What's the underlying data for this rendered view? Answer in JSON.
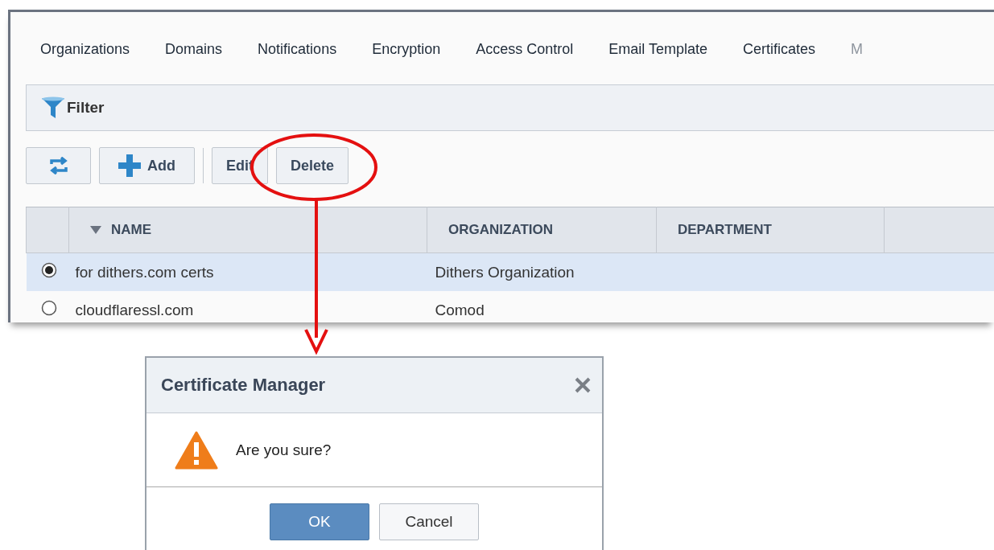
{
  "tabs": [
    {
      "label": "Organizations",
      "disabled": false
    },
    {
      "label": "Domains",
      "disabled": false
    },
    {
      "label": "Notifications",
      "disabled": false
    },
    {
      "label": "Encryption",
      "disabled": false
    },
    {
      "label": "Access Control",
      "disabled": false
    },
    {
      "label": "Email Template",
      "disabled": false
    },
    {
      "label": "Certificates",
      "disabled": false
    },
    {
      "label": "M",
      "disabled": true
    }
  ],
  "filter": {
    "label": "Filter"
  },
  "toolbar": [
    {
      "kind": "refresh"
    },
    {
      "kind": "add",
      "label": "Add"
    },
    {
      "kind": "separator"
    },
    {
      "kind": "text",
      "label": "Edit"
    },
    {
      "kind": "text",
      "label": "Delete"
    }
  ],
  "table": {
    "columns": [
      {
        "label": "NAME",
        "sorted": true
      },
      {
        "label": "ORGANIZATION",
        "sorted": false
      },
      {
        "label": "DEPARTMENT",
        "sorted": false
      }
    ],
    "rows": [
      {
        "selected": true,
        "name": "for dithers.com certs",
        "organization": "Dithers Organization"
      },
      {
        "selected": false,
        "name": "cloudflaressl.com",
        "organization": "Comod"
      }
    ]
  },
  "dialog": {
    "title": "Certificate Manager",
    "message": "Are you sure?",
    "buttons": [
      {
        "label": "OK",
        "primary": true
      },
      {
        "label": "Cancel",
        "primary": false
      }
    ]
  }
}
